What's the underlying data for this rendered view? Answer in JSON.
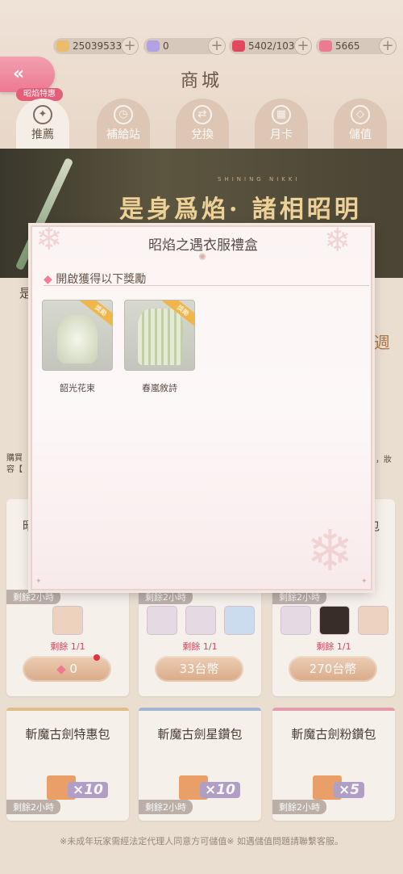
{
  "currencies": {
    "coins": "25039533",
    "diamonds": "0",
    "stamina": "5402/103",
    "pink_diamonds": "5665"
  },
  "header": {
    "title": "商城",
    "back_icon": "«",
    "promo_badge": "昭焰特惠"
  },
  "tabs": [
    {
      "label": "推薦",
      "icon": "crest"
    },
    {
      "label": "補給站",
      "icon": "clock"
    },
    {
      "label": "兌換",
      "icon": "exchange"
    },
    {
      "label": "月卡",
      "icon": "calendar"
    },
    {
      "label": "儲值",
      "icon": "diamond"
    }
  ],
  "banner": {
    "headline": "是身爲焰· 諸相昭明",
    "subtitle": "SHINING NIKKI"
  },
  "peek": {
    "left_text": "是",
    "right_text": "週",
    "desc_left_1": "購買",
    "desc_left_2": "容【",
    "desc_right": "，妝"
  },
  "cards_row1": [
    {
      "title": "昭",
      "remaining": "剩餘2小時",
      "stock": "剩餘 1/1",
      "price": "0",
      "price_icon": "diamond"
    },
    {
      "title": "",
      "remaining": "剩餘2小時",
      "stock": "剩餘 1/1",
      "price": "33台幣"
    },
    {
      "title": "包",
      "remaining": "剩餘2小時",
      "stock": "剩餘 1/1",
      "price": "270台幣"
    }
  ],
  "cards_row2": [
    {
      "title": "斬魔古劍特惠包",
      "multiplier": "×10",
      "remaining": "剩餘2小時"
    },
    {
      "title": "斬魔古劍星鑽包",
      "multiplier": "×10",
      "remaining": "剩餘2小時"
    },
    {
      "title": "斬魔古劍粉鑽包",
      "multiplier": "×5",
      "remaining": "剩餘2小時"
    }
  ],
  "footer": "※未成年玩家需經法定代理人同意方可儲值※ 如遇儲值問題請聯繫客服。",
  "modal": {
    "title": "昭焰之遇衣服禮盒",
    "reward_heading": "開啟獲得以下獎勵",
    "ribbon": "獎勵",
    "rewards": [
      {
        "name": "韶光花束"
      },
      {
        "name": "春嵐敘詩"
      }
    ]
  },
  "colors": {
    "accent_pink": "#f27c95",
    "gold": "#f3d69a",
    "price_red": "#d9475f"
  }
}
